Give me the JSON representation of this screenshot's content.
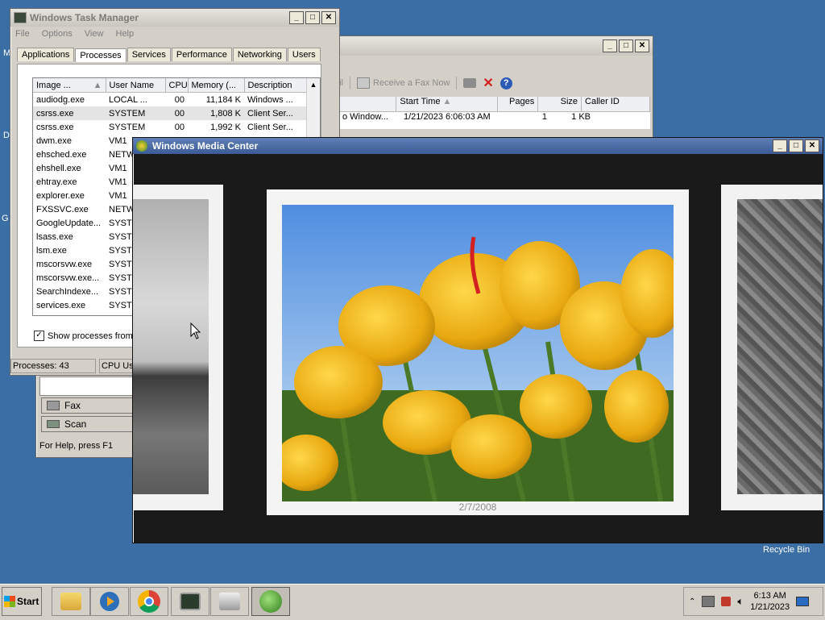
{
  "task_manager": {
    "title": "Windows Task Manager",
    "menu": [
      "File",
      "Options",
      "View",
      "Help"
    ],
    "tabs": [
      "Applications",
      "Processes",
      "Services",
      "Performance",
      "Networking",
      "Users"
    ],
    "columns": [
      "Image ...",
      "User Name",
      "CPU",
      "Memory (...",
      "Description"
    ],
    "rows": [
      [
        "audiodg.exe",
        "LOCAL ...",
        "00",
        "11,184 K",
        "Windows ..."
      ],
      [
        "csrss.exe",
        "SYSTEM",
        "00",
        "1,808 K",
        "Client Ser..."
      ],
      [
        "csrss.exe",
        "SYSTEM",
        "00",
        "1,992 K",
        "Client Ser..."
      ],
      [
        "dwm.exe",
        "VM1",
        "",
        "",
        ""
      ],
      [
        "ehsched.exe",
        "NETW",
        "",
        "",
        ""
      ],
      [
        "ehshell.exe",
        "VM1",
        "",
        "",
        ""
      ],
      [
        "ehtray.exe",
        "VM1",
        "",
        "",
        ""
      ],
      [
        "explorer.exe",
        "VM1",
        "",
        "",
        ""
      ],
      [
        "FXSSVC.exe",
        "NETW",
        "",
        "",
        ""
      ],
      [
        "GoogleUpdate...",
        "SYSTE",
        "",
        "",
        ""
      ],
      [
        "lsass.exe",
        "SYSTE",
        "",
        "",
        ""
      ],
      [
        "lsm.exe",
        "SYSTE",
        "",
        "",
        ""
      ],
      [
        "mscorsvw.exe",
        "SYSTE",
        "",
        "",
        ""
      ],
      [
        "mscorsvw.exe...",
        "SYSTE",
        "",
        "",
        ""
      ],
      [
        "SearchIndexe...",
        "SYSTE",
        "",
        "",
        ""
      ],
      [
        "services.exe",
        "SYSTE",
        "",
        "",
        ""
      ]
    ],
    "show_all_label": "Show processes from a",
    "status_processes": "Processes: 43",
    "status_cpu": "CPU Usa"
  },
  "fax": {
    "toolbar_receive": "Receive a Fax Now",
    "toolbar_prefix": "ail",
    "columns": [
      "Start Time",
      "Pages",
      "Size",
      "Caller ID"
    ],
    "row": {
      "name": "o Window...",
      "start_time": "1/21/2023 6:06:03 AM",
      "pages": "1",
      "size": "1 KB",
      "caller": ""
    },
    "nav_fax": "Fax",
    "nav_scan": "Scan",
    "status": "For Help, press F1"
  },
  "media_center": {
    "title": "Windows Media Center",
    "photo_date": "2/7/2008"
  },
  "desktop": {
    "recycle_bin": "Recycle Bin",
    "edge_letters": [
      "M",
      "D",
      "G"
    ]
  },
  "taskbar": {
    "start_label": "Start",
    "time": "6:13 AM",
    "date": "1/21/2023",
    "apps": [
      "explorer-icon",
      "media-player-icon",
      "chrome-icon",
      "task-manager-icon",
      "fax-scan-icon",
      "media-center-icon"
    ]
  }
}
